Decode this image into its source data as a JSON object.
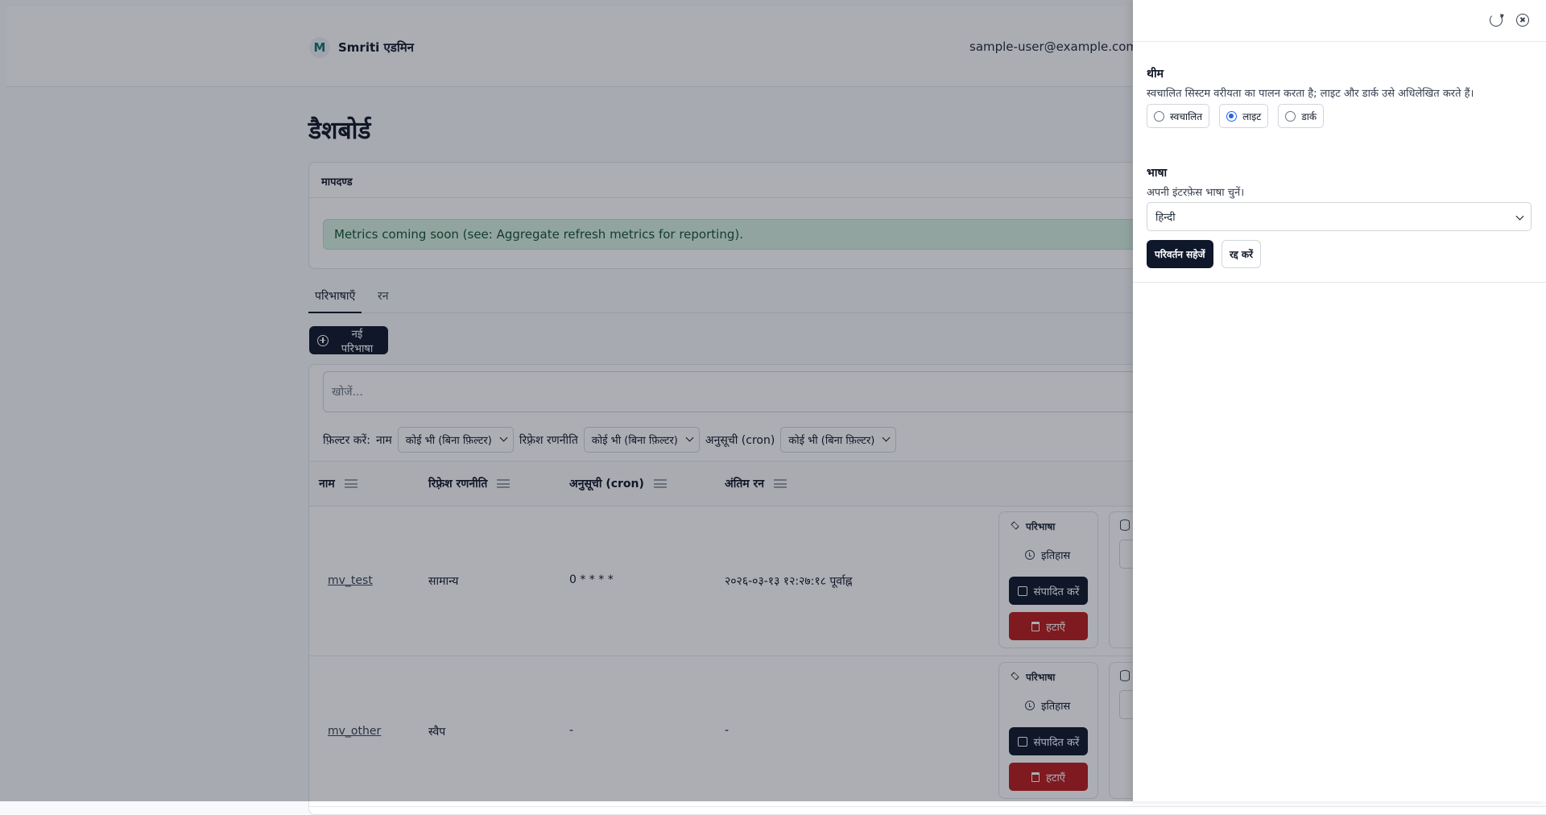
{
  "brand": {
    "name": "Smriti एडमिन",
    "logo_letter": "M"
  },
  "header": {
    "user_email": "sample-user@example.com के"
  },
  "page": {
    "title": "डैशबोर्ड"
  },
  "metrics": {
    "title": "मापदण्ड",
    "notice": "Metrics coming soon (see: Aggregate refresh metrics for reporting)."
  },
  "tabs": [
    {
      "label": "परिभाषाएँ",
      "active": true
    },
    {
      "label": "रन",
      "active": false
    }
  ],
  "actions": {
    "new_definition": "नई परिभाषा"
  },
  "search": {
    "placeholder": "खोजें...",
    "value": ""
  },
  "filters": {
    "label": "फ़िल्टर करें:",
    "name_label": "नाम",
    "name_value": "कोई भी (बिना फ़िल्टर)",
    "strategy_label": "रिफ़्रेश रणनीति",
    "strategy_value": "कोई भी (बिना फ़िल्टर)",
    "schedule_label": "अनुसूची (cron)",
    "schedule_value": "कोई भी (बिना फ़िल्टर)"
  },
  "table": {
    "columns": [
      "नाम",
      "रिफ़्रेश रणनीति",
      "अनुसूची (cron)",
      "अंतिम रन"
    ],
    "rows": [
      {
        "name": "mv_test",
        "strategy": "सामान्य",
        "schedule": "0 * * * *",
        "last_run": "२०२६-०३-१३ १२:२७:१८ पूर्वाह्न"
      },
      {
        "name": "mv_other",
        "strategy": "स्वैप",
        "schedule": "-",
        "last_run": "-"
      }
    ],
    "row_actions": {
      "definition": "परिभाषा",
      "history": "इतिहास",
      "edit": "संपादित करें",
      "delete": "हटाएँ"
    }
  },
  "drawer": {
    "theme": {
      "label": "थीम",
      "help": "स्वचालित सिस्टम वरीयता का पालन करता है; लाइट और डार्क उसे अधिलेखित करते हैं।",
      "options": [
        {
          "label": "स्वचालित",
          "checked": false
        },
        {
          "label": "लाइट",
          "checked": true
        },
        {
          "label": "डार्क",
          "checked": false
        }
      ]
    },
    "language": {
      "label": "भाषा",
      "help": "अपनी इंटरफ़ेस भाषा चुनें।",
      "value": "हिन्दी"
    },
    "save_label": "परिवर्तन सहेजें",
    "cancel_label": "रद्द करें"
  },
  "colors": {
    "primary": "#0f172a",
    "danger": "#b91c1c",
    "success_bg": "#d7f0e1",
    "radio_checked": "#2563eb"
  }
}
